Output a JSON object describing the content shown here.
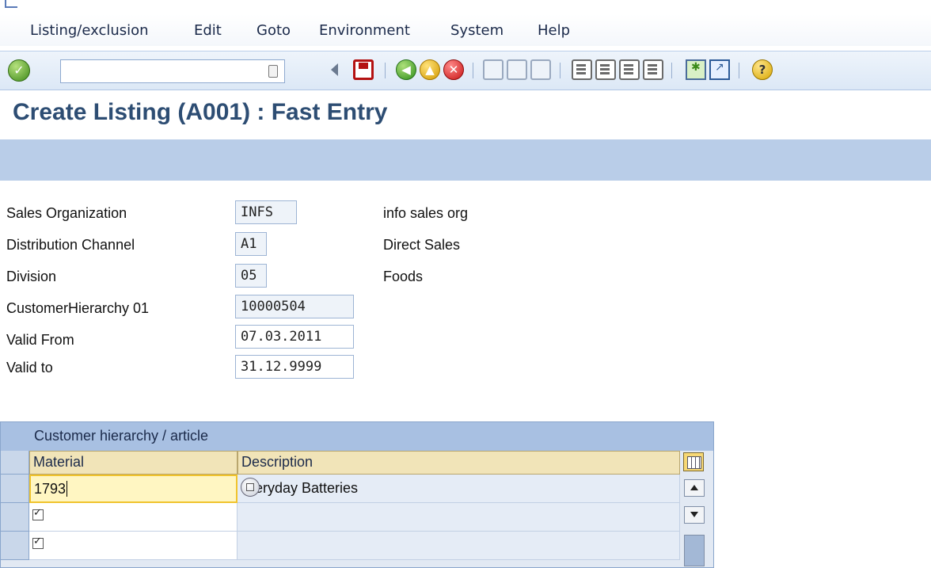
{
  "menu": [
    {
      "label": "Listing/exclusion"
    },
    {
      "label": "Edit"
    },
    {
      "label": "Goto"
    },
    {
      "label": "Environment"
    },
    {
      "label": "System"
    },
    {
      "label": "Help"
    }
  ],
  "toolbar": {
    "command_field_value": "",
    "icons": [
      "enter-icon",
      "command-dropdown-icon",
      "collapse-icon",
      "save-icon",
      "back-icon",
      "exit-icon",
      "cancel-icon",
      "print-icon",
      "find-icon",
      "find-next-icon",
      "first-page-icon",
      "previous-page-icon",
      "next-page-icon",
      "last-page-icon",
      "new-session-icon",
      "shortcut-icon",
      "help-icon"
    ]
  },
  "page_title": "Create Listing (A001) : Fast Entry",
  "form": {
    "sales_org": {
      "label": "Sales Organization",
      "value": "INFS",
      "desc": "info sales org"
    },
    "dist_channel": {
      "label": "Distribution Channel",
      "value": "A1",
      "desc": "Direct Sales"
    },
    "division": {
      "label": "Division",
      "value": "05",
      "desc": "Foods"
    },
    "cust_hier": {
      "label": "CustomerHierarchy 01",
      "value": "10000504"
    },
    "valid_from": {
      "label": "Valid From",
      "value": "07.03.2011"
    },
    "valid_to": {
      "label": "Valid to",
      "value": "31.12.9999"
    }
  },
  "table": {
    "title": "Customer hierarchy / article",
    "columns": [
      "Material",
      "Description"
    ],
    "rows": [
      {
        "material": "1793",
        "description": "eryday Batteries"
      },
      {
        "material": "",
        "description": ""
      },
      {
        "material": "",
        "description": ""
      }
    ]
  },
  "colors": {
    "title": "#2d4d73",
    "band": "#b9cde8",
    "header": "#f1e4b8",
    "table_bg": "#e2e9f3"
  }
}
